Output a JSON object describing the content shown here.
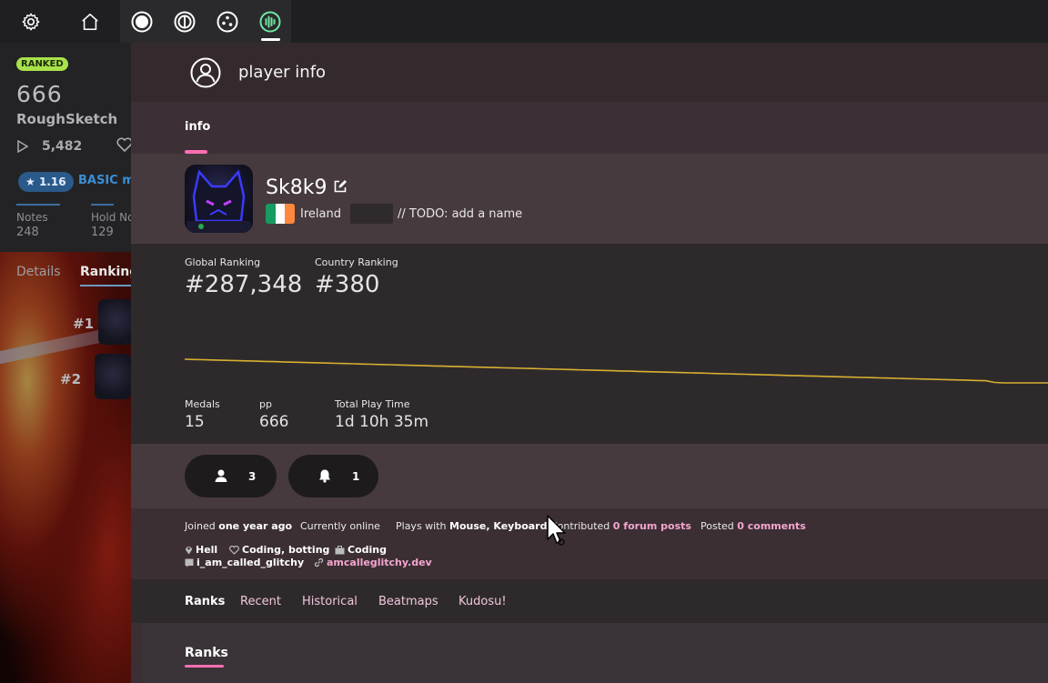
{
  "toolbar": {
    "icons": [
      "gear-icon",
      "home-icon",
      "ruleset-osu-icon",
      "ruleset-taiko-icon",
      "ruleset-catch-icon",
      "ruleset-mania-icon"
    ],
    "active_color": "#6ee7a3"
  },
  "beatmap": {
    "status": "RANKED",
    "title": "666",
    "artist": "RoughSketch",
    "plays": "5,482",
    "star_rating": "1.16",
    "difficulty_name": "BASIC m",
    "stats": [
      {
        "label": "Notes",
        "value": "248"
      },
      {
        "label": "Hold No",
        "value": "129"
      }
    ],
    "tabs": [
      "Details",
      "Ranking"
    ],
    "ranks": [
      "#1",
      "#2"
    ]
  },
  "overlay": {
    "title": "player info",
    "tab": "info",
    "accent": "#ff6fb0"
  },
  "profile": {
    "username": "Sk8k9",
    "country": "Ireland",
    "flag_colors": [
      "#169b62",
      "#ffffff",
      "#ff883e"
    ],
    "todo": "// TODO: add a name"
  },
  "stats": {
    "global_ranking_label": "Global Ranking",
    "global_ranking": "#287,348",
    "country_ranking_label": "Country Ranking",
    "country_ranking": "#380",
    "medals_label": "Medals",
    "medals": "15",
    "pp_label": "pp",
    "pp": "666",
    "playtime_label": "Total Play Time",
    "playtime": "1d 10h 35m"
  },
  "rank_history": {
    "type": "line",
    "series": [
      {
        "values": [
          100,
          99,
          98,
          97,
          96,
          95,
          94,
          93,
          92,
          91,
          90,
          89,
          88,
          87,
          86,
          85,
          84,
          83,
          82,
          81,
          80,
          79,
          78,
          77,
          76,
          75,
          74,
          73,
          72,
          71,
          70,
          69,
          68,
          67,
          66,
          65,
          64,
          63,
          62,
          61,
          60,
          59,
          58,
          57,
          56,
          55,
          54,
          53,
          52,
          51,
          50,
          49,
          48,
          47,
          46,
          45,
          44,
          43,
          42,
          41,
          40,
          39,
          38,
          37,
          36,
          35,
          34,
          33,
          32,
          31,
          30,
          29,
          28,
          27,
          26,
          25,
          24,
          23,
          22,
          21,
          20,
          19,
          18,
          17,
          16,
          15,
          14,
          13,
          12,
          11,
          10,
          3,
          1,
          1,
          1,
          1,
          1,
          1
        ]
      }
    ],
    "color": "#d9b030"
  },
  "social": {
    "followers": "3",
    "subscribers": "1"
  },
  "info": {
    "joined_prefix": "Joined",
    "joined": "one year ago",
    "online": "Currently online",
    "plays_with_prefix": "Plays with",
    "plays_with": "Mouse, Keyboard",
    "contributed_prefix": "Contributed",
    "forum_posts": "0 forum posts",
    "posted_prefix": "Posted",
    "comments": "0 comments",
    "location": "Hell",
    "interests": "Coding, botting",
    "occupation": "Coding",
    "discord": "i_am_called_glitchy",
    "website": "amcalleglitchy.dev"
  },
  "subtabs": [
    "Ranks",
    "Recent",
    "Historical",
    "Beatmaps",
    "Kudosu!"
  ],
  "section_title": "Ranks"
}
